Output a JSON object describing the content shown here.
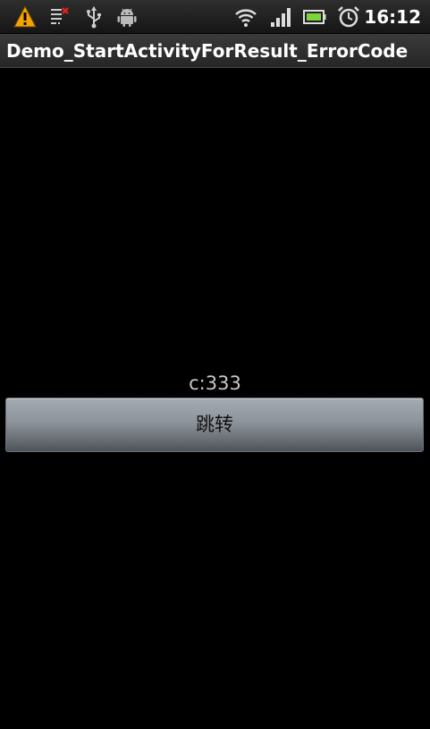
{
  "status_bar": {
    "time": "16:12",
    "icons": [
      "warning-icon",
      "debug-mode-icon",
      "usb-icon",
      "android-icon",
      "wifi-icon",
      "signal-icon",
      "battery-icon",
      "alarm-icon"
    ],
    "warning_color": "#f5a300"
  },
  "app": {
    "title": "Demo_StartActivityForResult_ErrorCode"
  },
  "content": {
    "result_text": "c:333",
    "jump_button_label": "跳转"
  }
}
